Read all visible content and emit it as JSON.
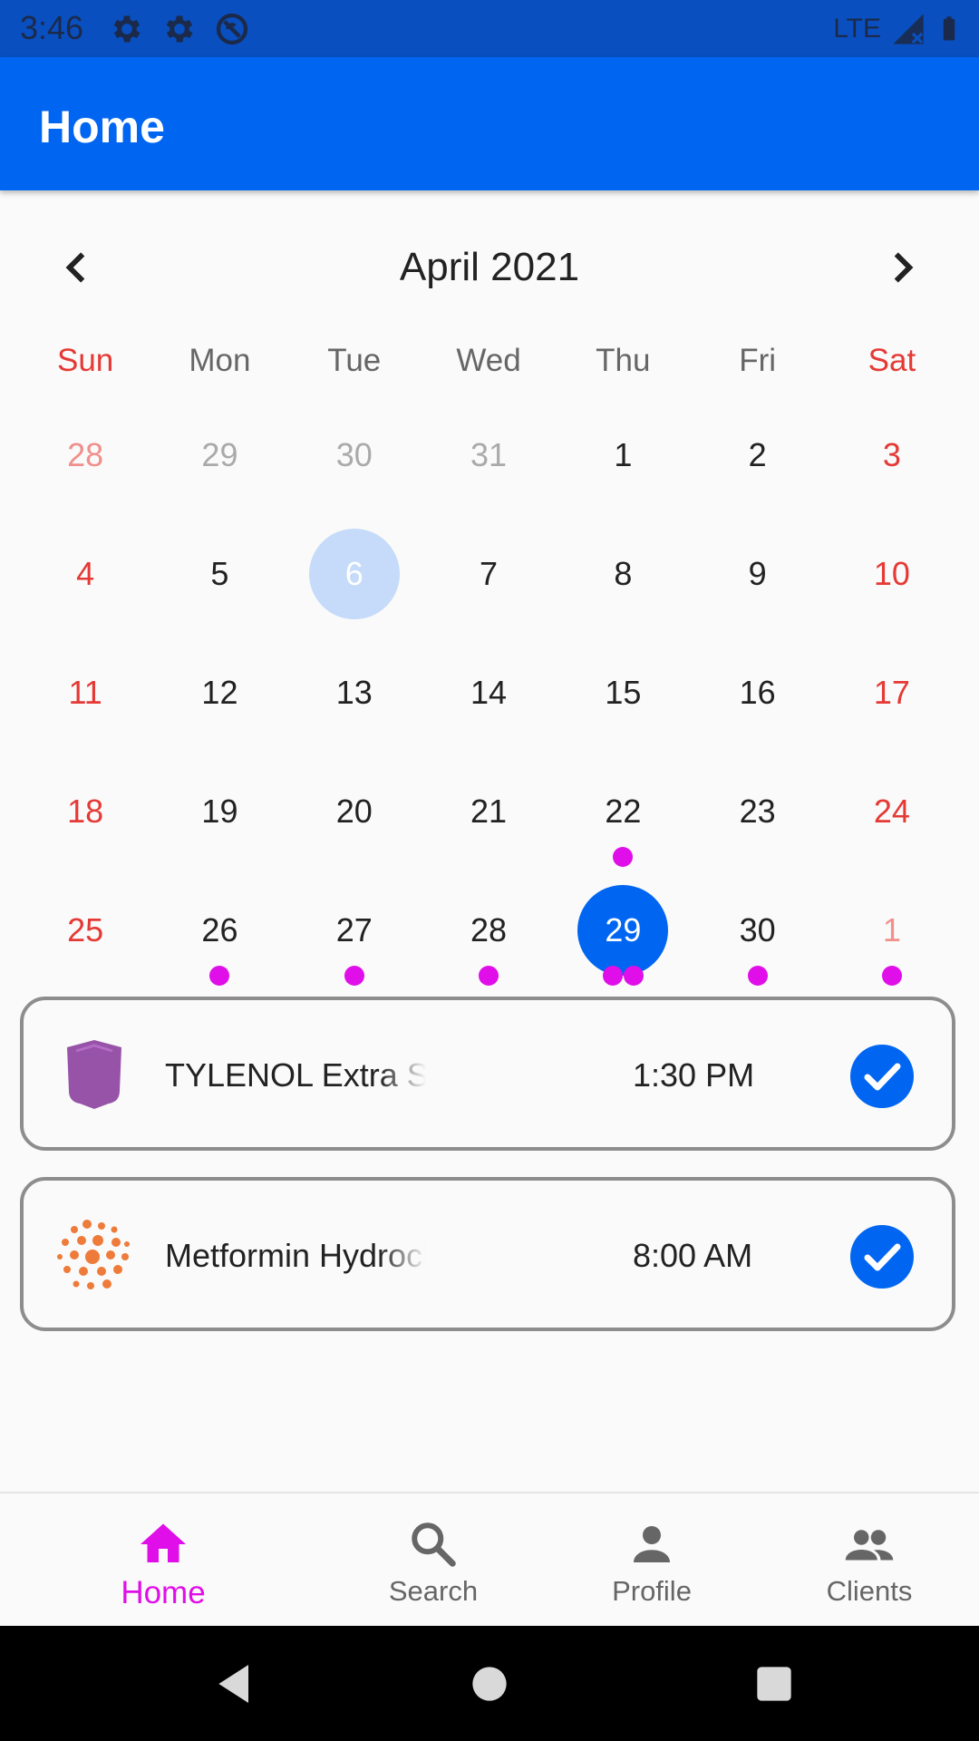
{
  "status_bar": {
    "time": "3:46",
    "network": "LTE"
  },
  "app_bar": {
    "title": "Home"
  },
  "calendar": {
    "month_title": "April 2021",
    "weekdays": [
      "Sun",
      "Mon",
      "Tue",
      "Wed",
      "Thu",
      "Fri",
      "Sat"
    ],
    "days": [
      {
        "n": "28",
        "outside": true
      },
      {
        "n": "29",
        "outside": true
      },
      {
        "n": "30",
        "outside": true
      },
      {
        "n": "31",
        "outside": true
      },
      {
        "n": "1"
      },
      {
        "n": "2"
      },
      {
        "n": "3"
      },
      {
        "n": "4"
      },
      {
        "n": "5"
      },
      {
        "n": "6",
        "today": true
      },
      {
        "n": "7"
      },
      {
        "n": "8"
      },
      {
        "n": "9"
      },
      {
        "n": "10"
      },
      {
        "n": "11"
      },
      {
        "n": "12"
      },
      {
        "n": "13"
      },
      {
        "n": "14"
      },
      {
        "n": "15"
      },
      {
        "n": "16"
      },
      {
        "n": "17"
      },
      {
        "n": "18"
      },
      {
        "n": "19"
      },
      {
        "n": "20"
      },
      {
        "n": "21"
      },
      {
        "n": "22",
        "dots": 1
      },
      {
        "n": "23"
      },
      {
        "n": "24"
      },
      {
        "n": "25"
      },
      {
        "n": "26",
        "dots": 1
      },
      {
        "n": "27",
        "dots": 1
      },
      {
        "n": "28",
        "dots": 1
      },
      {
        "n": "29",
        "selected": true,
        "dots": 2
      },
      {
        "n": "30",
        "dots": 1
      },
      {
        "n": "1",
        "outside": true,
        "dots": 1
      }
    ],
    "colors": {
      "accent": "#0066f2",
      "weekend": "#e53935",
      "event_dot": "#e00ee8",
      "today_circle": "#c6dbf9"
    }
  },
  "medications": [
    {
      "name": "TYLENOL Extra Strength",
      "time": "1:30 PM",
      "icon": "purple-shield-pill-icon",
      "checked": true
    },
    {
      "name": "Metformin Hydrochloride",
      "time": "8:00 AM",
      "icon": "orange-dots-pill-icon",
      "checked": true
    }
  ],
  "bottom_nav": {
    "items": [
      {
        "label": "Home",
        "icon": "home-icon",
        "active": true
      },
      {
        "label": "Search",
        "icon": "search-icon"
      },
      {
        "label": "Profile",
        "icon": "person-icon"
      },
      {
        "label": "Clients",
        "icon": "people-icon"
      }
    ],
    "active_color": "#e00ee8"
  }
}
